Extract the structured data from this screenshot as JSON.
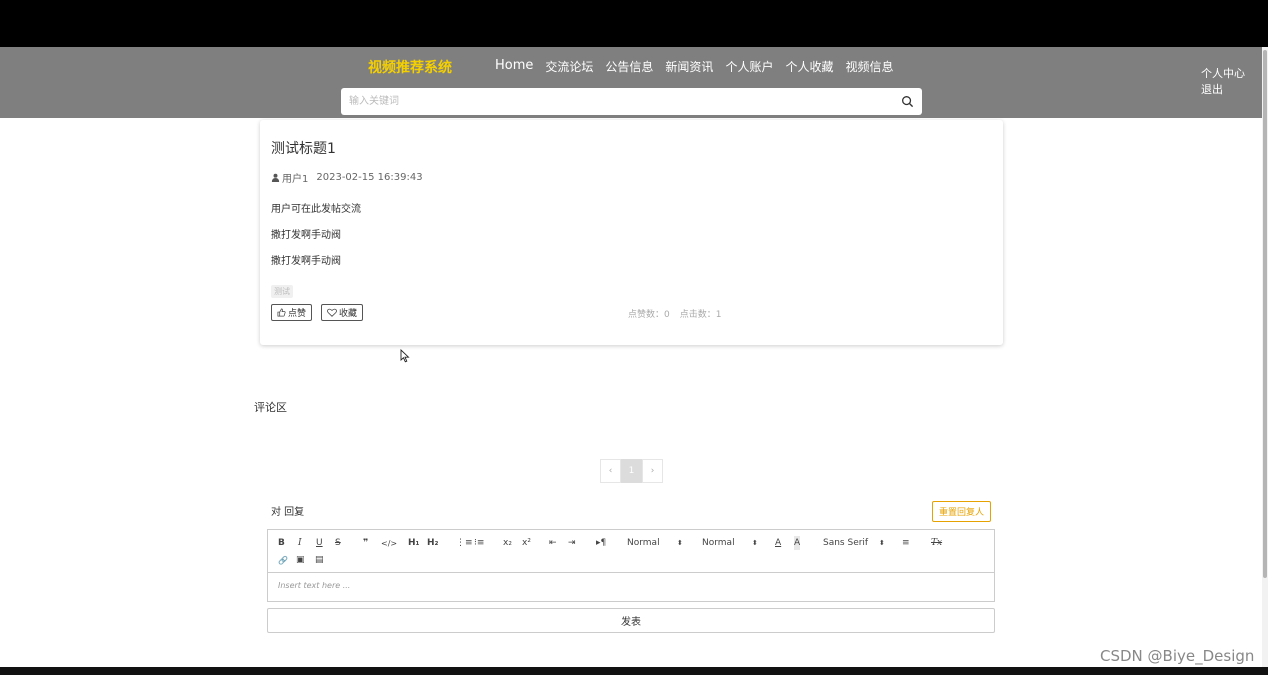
{
  "header": {
    "brand": "视频推荐系统",
    "nav": [
      "Home",
      "交流论坛",
      "公告信息",
      "新闻资讯",
      "个人账户",
      "个人收藏",
      "视频信息"
    ],
    "user_menu": [
      "个人中心",
      "退出"
    ],
    "search": {
      "placeholder": "输入关键词",
      "value": ""
    }
  },
  "post": {
    "title": "测试标题1",
    "author": "用户1",
    "date": "2023-02-15 16:39:43",
    "lines": [
      "用户可在此发帖交流",
      "撒打发啊手动阀",
      "撒打发啊手动阀"
    ],
    "tag": "测试",
    "like_label": "点赞",
    "collect_label": "收藏",
    "likes_label": "点赞数：",
    "likes": "0",
    "clicks_label": "点击数：",
    "clicks": "1"
  },
  "comments": {
    "title": "评论区",
    "pager": {
      "prev": "‹",
      "current": "1",
      "next": "›"
    }
  },
  "reply": {
    "label": "对 回复",
    "reset_label": "重置回复人",
    "editor_placeholder": "Insert text here ...",
    "toolbar": {
      "bold": "B",
      "italic": "I",
      "underline": "U",
      "strike": "S",
      "blockquote": "❞",
      "code": "</>",
      "h1": "H₁",
      "h2": "H₂",
      "ordered_list": "⋮≡",
      "bullet_list": "⁝≡",
      "sub": "x₂",
      "sup": "x²",
      "outdent": "⇤",
      "indent": "⇥",
      "direction": "▸¶",
      "size1": "Normal",
      "size2": "Normal",
      "color": "A",
      "background": "A",
      "font": "Sans Serif",
      "align": "≡",
      "clean": "Tx",
      "link": "🔗",
      "image": "▣",
      "video": "▤"
    },
    "submit_label": "发表"
  },
  "watermark": "CSDN @Biye_Design"
}
